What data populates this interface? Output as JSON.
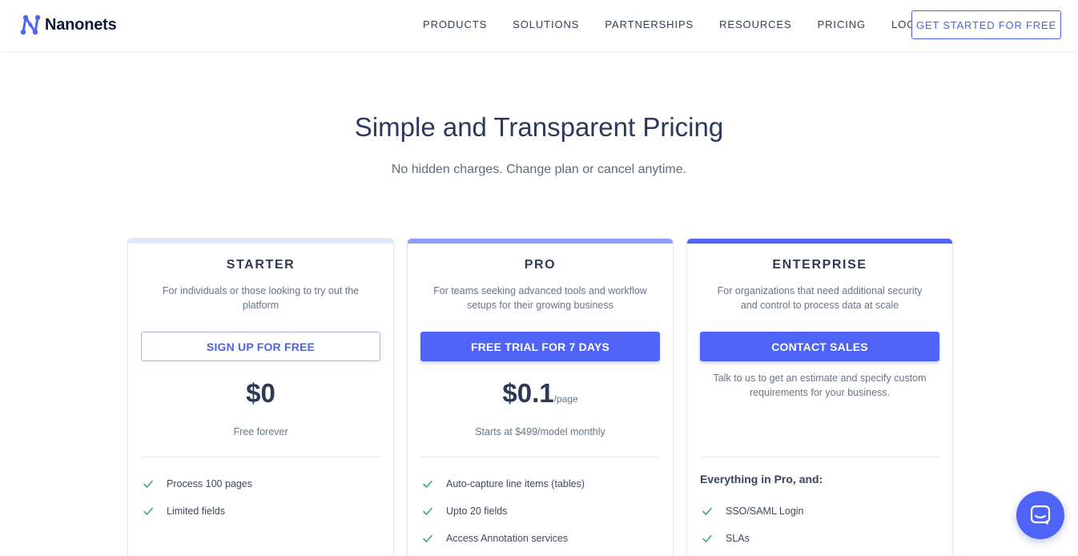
{
  "brand": {
    "name": "Nanonets",
    "accent": "#4f63f7"
  },
  "nav": {
    "links": [
      "PRODUCTS",
      "SOLUTIONS",
      "PARTNERSHIPS",
      "RESOURCES",
      "PRICING",
      "LOG IN"
    ],
    "cta": "GET STARTED FOR FREE"
  },
  "hero": {
    "title": "Simple and Transparent Pricing",
    "subtitle": "No hidden charges. Change plan or cancel anytime."
  },
  "plans": {
    "starter": {
      "name": "STARTER",
      "desc": "For individuals or those looking to try out the platform",
      "button": "SIGN UP FOR FREE",
      "price": "$0",
      "note": "Free forever",
      "features": [
        "Process 100 pages",
        "Limited fields"
      ],
      "bar_color": "#e3e8fb"
    },
    "pro": {
      "name": "PRO",
      "desc": "For teams seeking advanced tools and workflow setups for their growing business",
      "button": "FREE TRIAL FOR 7 DAYS",
      "price": "$0.1",
      "unit": "/page",
      "note": "Starts at $499/model monthly",
      "features": [
        "Auto-capture line items (tables)",
        "Upto 20 fields",
        "Access Annotation services"
      ],
      "bar_color": "#8d9cf8"
    },
    "enterprise": {
      "name": "ENTERPRISE",
      "desc": "For organizations that need additional security and control to process data at scale",
      "button": "CONTACT SALES",
      "note": "Talk to us to get an estimate and specify custom requirements for your business.",
      "features_heading": "Everything in Pro, and:",
      "features": [
        "SSO/SAML Login",
        "SLAs"
      ],
      "bar_color": "#4f63f7"
    }
  },
  "chat": {
    "icon": "chat-bubble-icon"
  }
}
